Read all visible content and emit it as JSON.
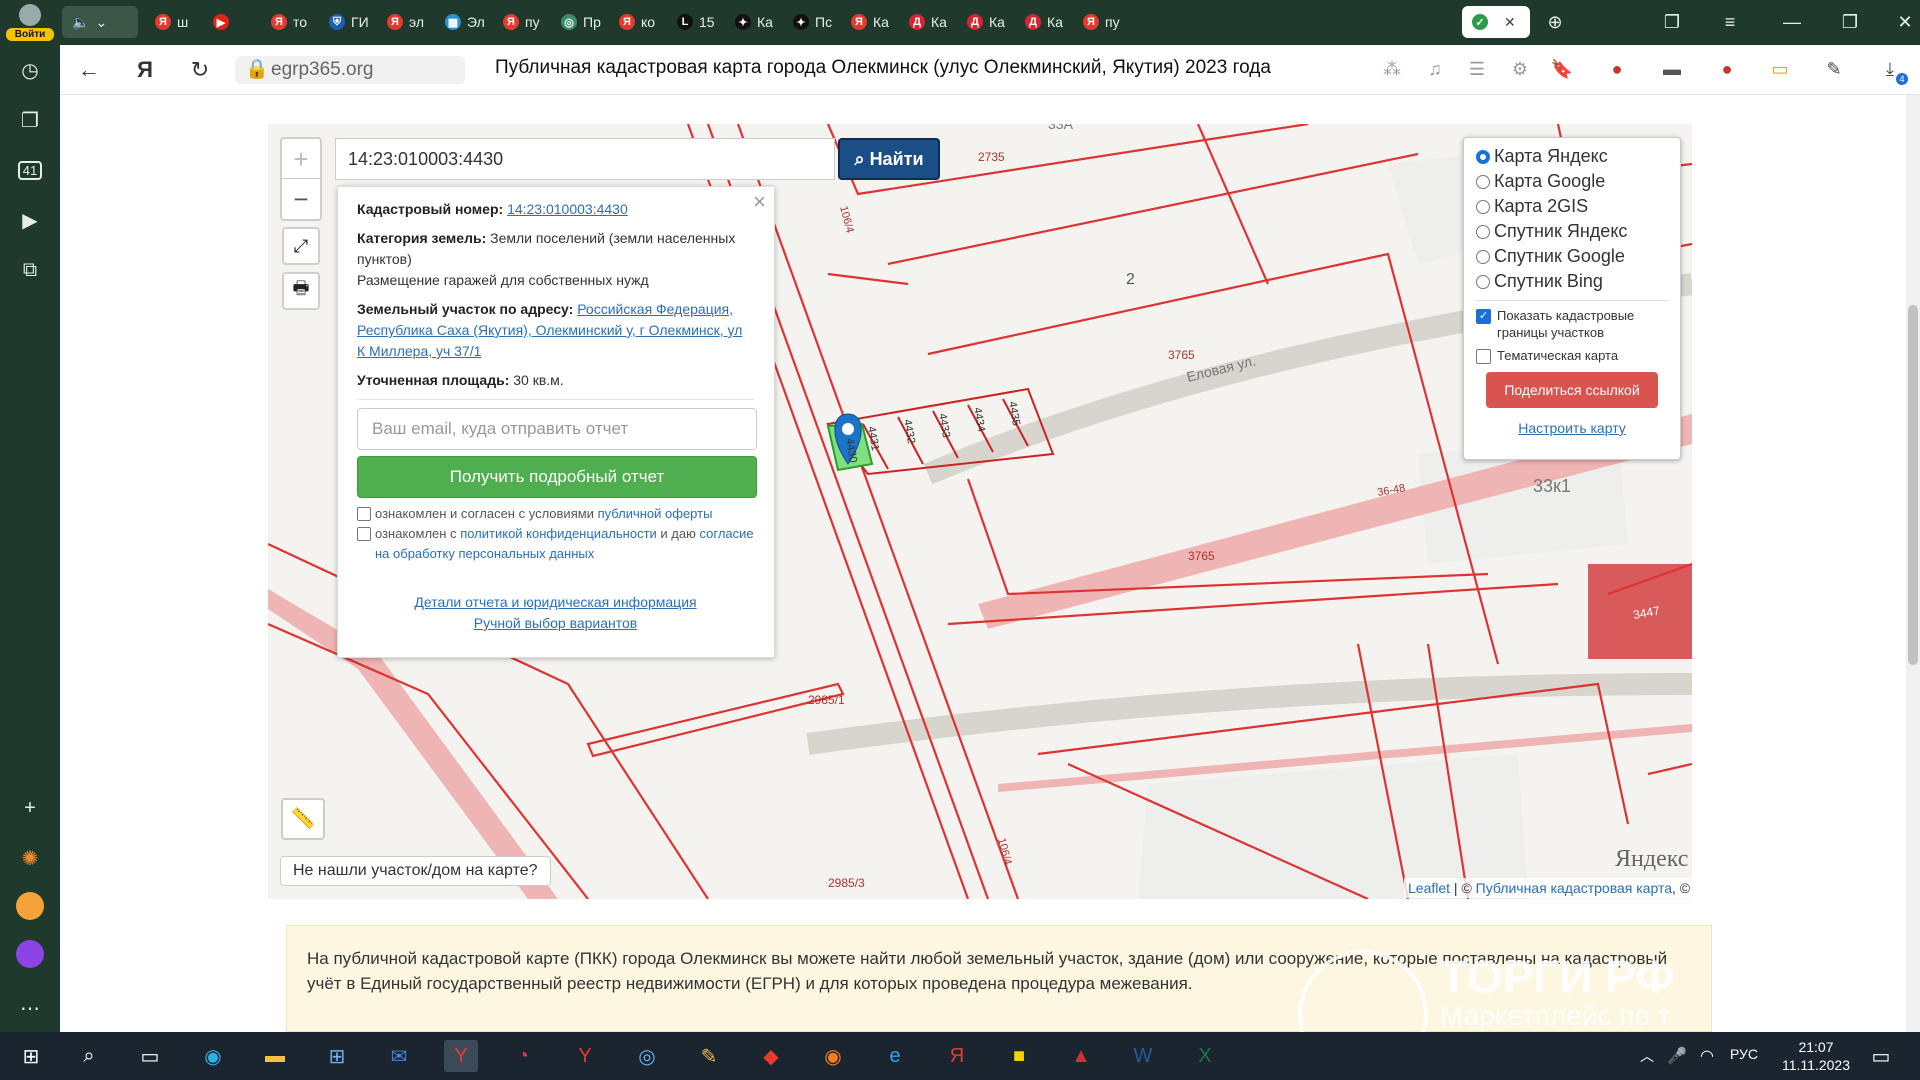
{
  "sidebar": {
    "login_label": "Войти",
    "badge_count": "41"
  },
  "tabs": [
    {
      "label": "ш",
      "fav": "Я",
      "color": "#e63a2e"
    },
    {
      "label": "",
      "fav": "▶",
      "color": "#e62117"
    },
    {
      "label": "то",
      "fav": "Я",
      "color": "#e63a2e"
    },
    {
      "label": "ГИ",
      "fav": "⛨",
      "color": "#1a5fb4"
    },
    {
      "label": "эл",
      "fav": "Я",
      "color": "#e63a2e"
    },
    {
      "label": "Эл",
      "fav": "▦",
      "color": "#2d8fd5"
    },
    {
      "label": "пу",
      "fav": "Я",
      "color": "#e63a2e"
    },
    {
      "label": "Пр",
      "fav": "◎",
      "color": "#3c8d6b"
    },
    {
      "label": "ко",
      "fav": "Я",
      "color": "#e63a2e"
    },
    {
      "label": "15",
      "fav": "L",
      "color": "#111111"
    },
    {
      "label": "Ка",
      "fav": "✦",
      "color": "#111111"
    },
    {
      "label": "Пс",
      "fav": "✦",
      "color": "#111111"
    },
    {
      "label": "Ка",
      "fav": "Я",
      "color": "#e63a2e"
    },
    {
      "label": "Ка",
      "fav": "Д",
      "color": "#d9232e"
    },
    {
      "label": "Ка",
      "fav": "Д",
      "color": "#d9232e"
    },
    {
      "label": "Ка",
      "fav": "Д",
      "color": "#d9232e"
    },
    {
      "label": "пу",
      "fav": "Я",
      "color": "#e63a2e"
    }
  ],
  "address": {
    "url": "egrp365.org",
    "title": "Публичная кадастровая карта города Олекминск (улус Олекминский, Якутия) 2023 года",
    "downloads_badge": "4"
  },
  "map": {
    "search_value": "14:23:010003:4430",
    "search_button": "Найти",
    "zoom_in": "+",
    "zoom_out": "−",
    "not_found": "Не нашли участок/дом на карте?",
    "attribution_leaflet": "Leaflet",
    "attribution_sep": " | © ",
    "attribution_pkk": "Публичная кадастровая карта",
    "attribution_tail": ", ©",
    "yandex_logo": "Яндекс",
    "labels": {
      "l2735": "2735",
      "l33a": "33А",
      "l2": "2",
      "l3765a": "3765",
      "street": "Еловая ул.",
      "l3648": "36-48",
      "l3765b": "3765",
      "l33k1": "33к1",
      "l3447": "3447",
      "l106a": "106/4",
      "l106b": "106/4",
      "l2985_1": "2985/1",
      "l2985_3": "2985/3",
      "p4430": "4430",
      "p4431": "4431",
      "p4432": "4432",
      "p4433": "4433",
      "p4434": "4434",
      "p4435": "4435"
    }
  },
  "popup": {
    "cad_label": "Кадастровый номер:",
    "cad_value": "14:23:010003:4430",
    "cat_label": "Категория земель:",
    "cat_value": "Земли поселений (земли населенных пунктов)",
    "usage": "Размещение гаражей для собственных нужд",
    "addr_label": "Земельный участок по адресу:",
    "addr_value": "Российская Федерация, Республика Саха (Якутия), Олекминский у, г Олекминск, ул К Миллера, уч 37/1",
    "area_label": "Уточненная площадь:",
    "area_value": "30 кв.м.",
    "email_placeholder": "Ваш email, куда отправить отчет",
    "report_button": "Получить подробный отчет",
    "agree1_text": "ознакомлен и согласен с условиями",
    "agree1_link": "публичной оферты",
    "agree2_text": "ознакомлен с",
    "agree2_link": "политикой конфиденциальности",
    "agree2_mid": "и даю",
    "agree2_link2": "согласие на обработку персональных данных",
    "details_link": "Детали отчета и юридическая информация",
    "manual_link": "Ручной выбор вариантов",
    "close": "×"
  },
  "layers": {
    "options": [
      "Карта Яндекс",
      "Карта Google",
      "Карта 2GIS",
      "Спутник Яндекс",
      "Спутник Google",
      "Спутник Bing"
    ],
    "selected_index": 0,
    "show_borders": "Показать кадастровые границы участков",
    "show_borders_checked": true,
    "thematic": "Тематическая карта",
    "thematic_checked": false,
    "share_button": "Поделиться ссылкой",
    "configure_link": "Настроить карту"
  },
  "info": {
    "text": "На публичной кадастровой карте (ПКК) города Олекминск вы можете найти любой земельный участок, здание (дом) или сооружение, которые поставлены на кадастровый учёт в Единый государственный реестр недвижимости (ЕГРН) и для которых проведена процедура межевания.",
    "watermark1": "ТОРГИ РФ",
    "watermark2": "Маркетплейс по т"
  },
  "taskbar": {
    "lang": "РУС",
    "time": "21:07",
    "date": "11.11.2023"
  }
}
